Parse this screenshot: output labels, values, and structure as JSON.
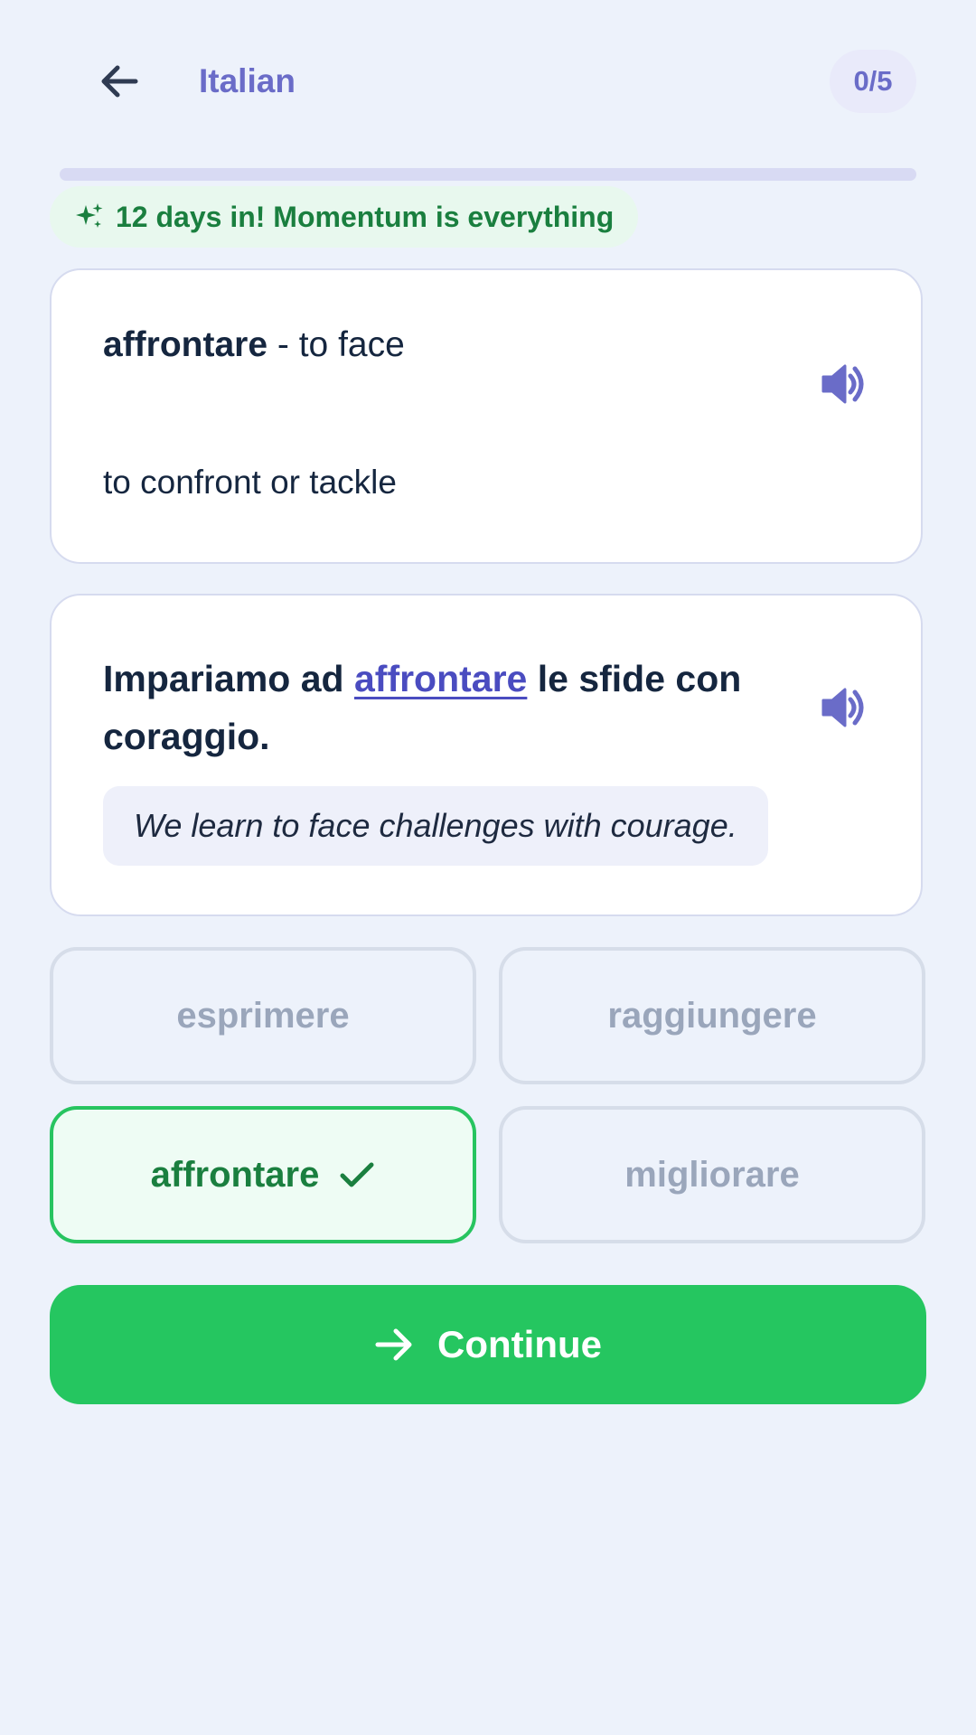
{
  "header": {
    "back_icon": "arrow-left-icon",
    "title": "Italian",
    "score": "0/5"
  },
  "progress": {
    "fraction": 0
  },
  "streak": {
    "icon": "sparkles-icon",
    "text": "12 days in! Momentum is everything"
  },
  "word_card": {
    "term": "affrontare",
    "separator": " - ",
    "gloss": "to face",
    "definition": "to confront or tackle",
    "speaker_icon": "speaker-icon"
  },
  "sentence_card": {
    "before": "Impariamo ad ",
    "highlight": "affrontare",
    "after": " le sfide con coraggio.",
    "translation": "We learn to face challenges with courage.",
    "speaker_icon": "speaker-icon"
  },
  "options": [
    {
      "label": "esprimere",
      "state": "disabled"
    },
    {
      "label": "raggiungere",
      "state": "disabled"
    },
    {
      "label": "affrontare",
      "state": "correct",
      "icon": "checkmark-icon"
    },
    {
      "label": "migliorare",
      "state": "disabled"
    }
  ],
  "continue": {
    "label": "Continue",
    "icon": "arrow-right-icon"
  },
  "colors": {
    "background": "#edf2fb",
    "accent": "#6a6cc8",
    "success": "#25c660",
    "success_text": "#1a7f3f",
    "text": "#15263f",
    "muted": "#9aa6bb"
  }
}
